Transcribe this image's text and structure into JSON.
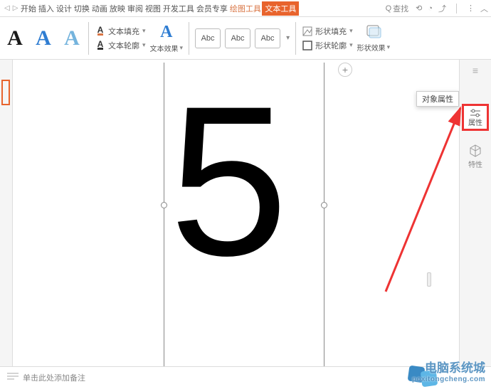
{
  "menu": {
    "start": "开始",
    "insert": "插入",
    "design": "设计",
    "switch": "切换",
    "anim": "动画",
    "show": "放映",
    "review": "审阅",
    "view": "视图",
    "dev": "开发工具",
    "vip": "会员专享",
    "drawing": "绘图工具",
    "texttool": "文本工具",
    "search": "查找"
  },
  "ribbon": {
    "text_fill": "文本填充",
    "text_outline": "文本轮廓",
    "text_effect": "文本效果",
    "abc": "Abc",
    "shape_fill": "形状填充",
    "shape_outline": "形状轮廓",
    "shape_effect": "形状效果"
  },
  "canvas": {
    "big_number": "5"
  },
  "popup": {
    "obj_props": "对象属性"
  },
  "sidebar": {
    "props": "属性",
    "features": "特性"
  },
  "footer": {
    "notes_placeholder": "单击此处添加备注"
  },
  "watermark": {
    "line1": "电脑系统城",
    "line2": "pcxitongcheng.com"
  }
}
